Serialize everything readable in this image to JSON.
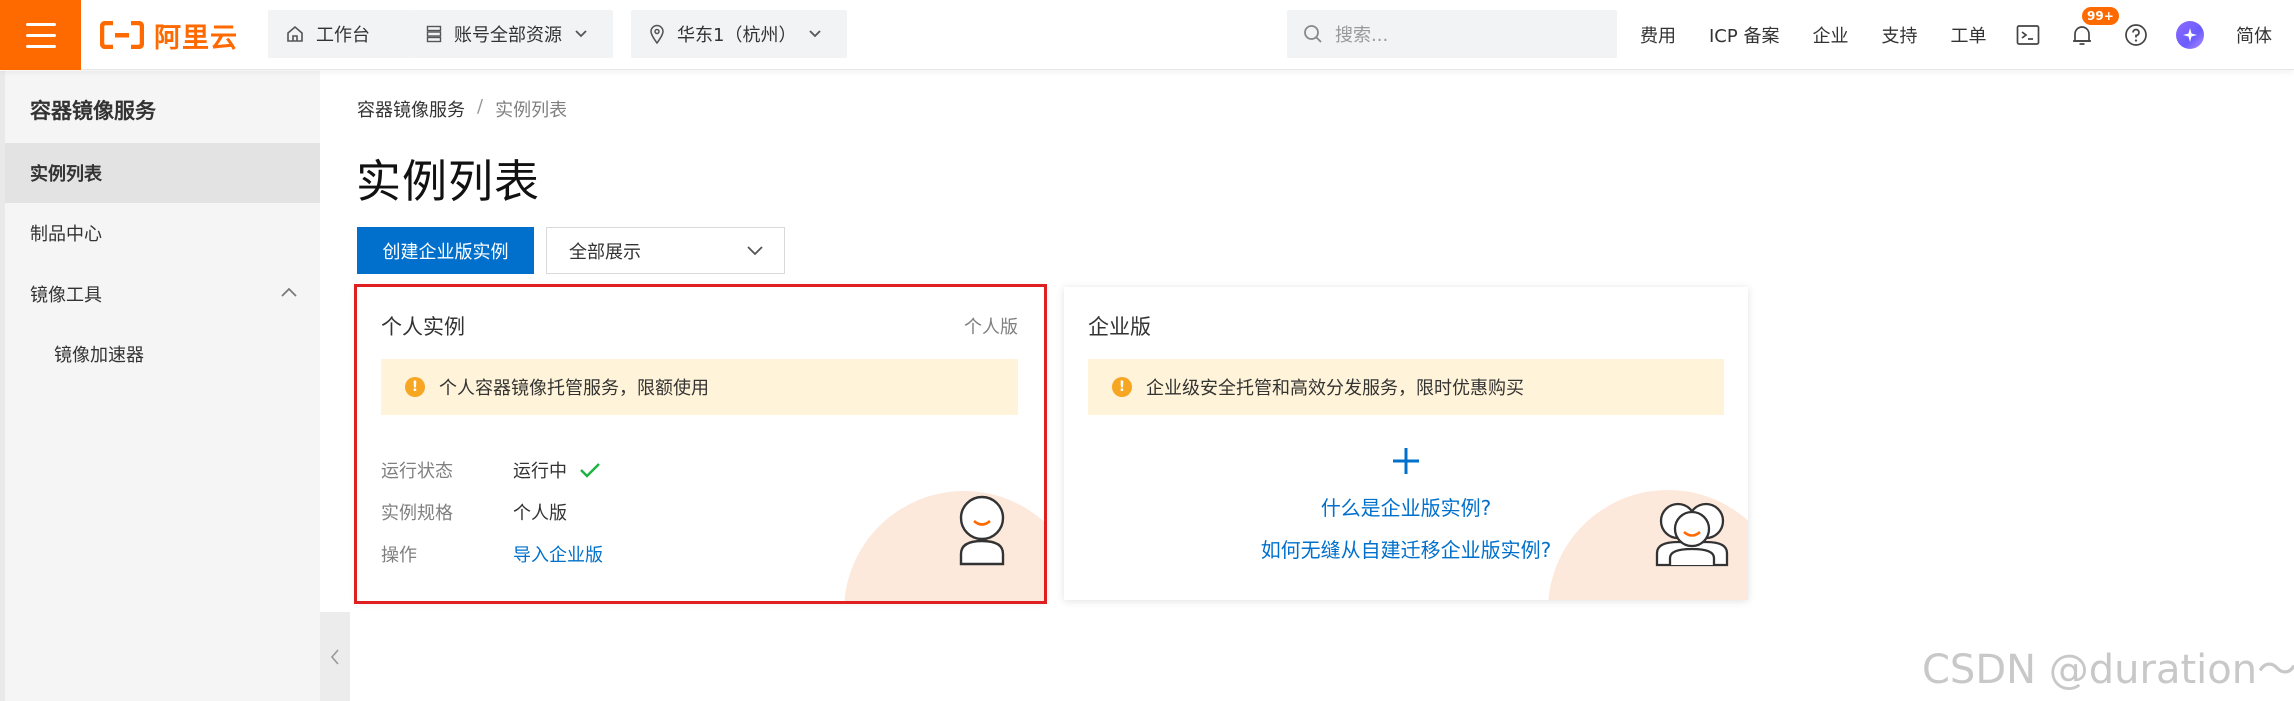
{
  "topbar": {
    "logo_text": "阿里云",
    "workbench_label": "工作台",
    "resources_label": "账号全部资源",
    "region_label": "华东1（杭州）",
    "search_placeholder": "搜索...",
    "links": [
      "费用",
      "ICP 备案",
      "企业",
      "支持",
      "工单"
    ],
    "notification_badge": "99+",
    "language": "简体",
    "accent_color": "#ff6a00"
  },
  "sidebar": {
    "title": "容器镜像服务",
    "items": [
      {
        "label": "实例列表",
        "active": true
      },
      {
        "label": "制品中心"
      },
      {
        "label": "镜像工具",
        "expanded": true
      },
      {
        "label": "镜像加速器"
      }
    ]
  },
  "main": {
    "breadcrumb": [
      "容器镜像服务",
      "实例列表"
    ],
    "breadcrumb_sep": "/",
    "title": "实例列表",
    "create_button": "创建企业版实例",
    "filter_select": "全部展示"
  },
  "personal_card": {
    "title": "个人实例",
    "tag": "个人版",
    "notice": "个人容器镜像托管服务，限额使用",
    "rows": [
      {
        "key": "运行状态",
        "value": "运行中"
      },
      {
        "key": "实例规格",
        "value": "个人版"
      },
      {
        "key": "操作",
        "value": "导入企业版"
      }
    ]
  },
  "enterprise_card": {
    "title": "企业版",
    "notice": "企业级安全托管和高效分发服务，限时优惠购买",
    "link1": "什么是企业版实例?",
    "link2": "如何无缝从自建迁移企业版实例?"
  },
  "watermark": "CSDN @duration～"
}
